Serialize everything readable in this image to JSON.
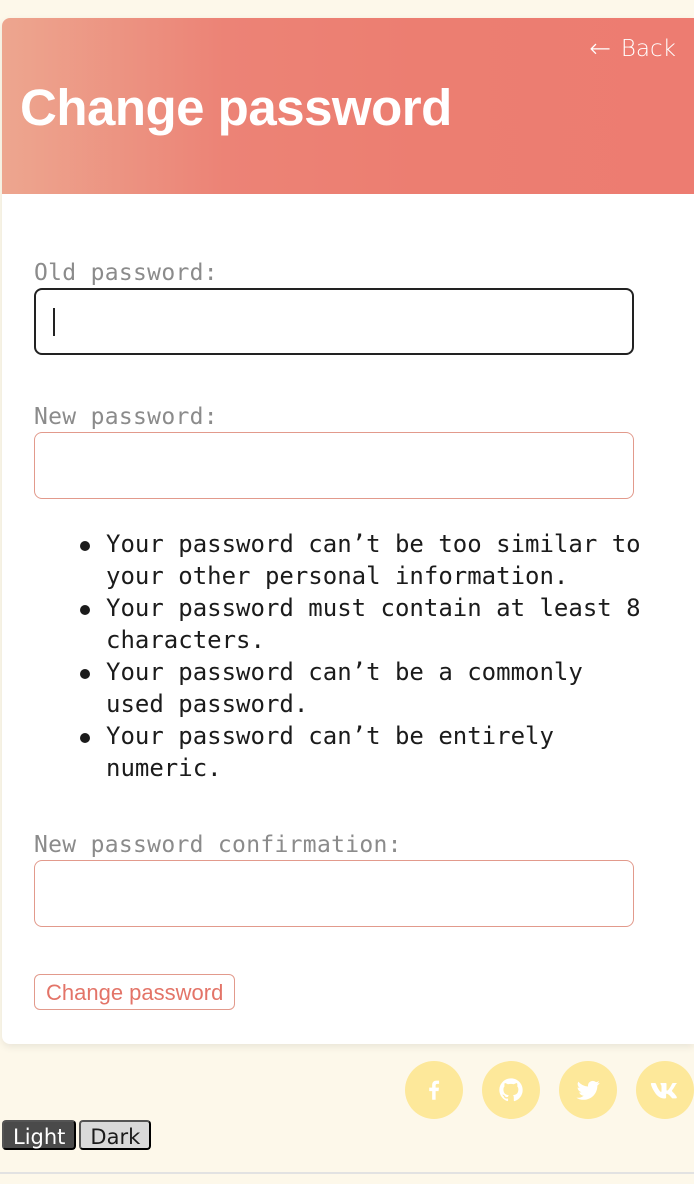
{
  "header": {
    "back_label": "Back",
    "back_arrow": "←",
    "title": "Change password",
    "gradient_colors": [
      "#eda68f",
      "#ec7e71"
    ]
  },
  "form": {
    "old_password_label": "Old password:",
    "old_password_value": "",
    "new_password_label": "New password:",
    "new_password_value": "",
    "help_items": [
      "Your password can’t be too similar to your other personal information.",
      "Your password must contain at least 8 characters.",
      "Your password can’t be a commonly used password.",
      "Your password can’t be entirely numeric."
    ],
    "confirm_label": "New password confirmation:",
    "confirm_value": "",
    "submit_label": "Change password"
  },
  "socials": [
    {
      "icon": "facebook-icon"
    },
    {
      "icon": "github-icon"
    },
    {
      "icon": "twitter-icon"
    },
    {
      "icon": "vk-icon"
    }
  ],
  "theme": {
    "light_label": "Light",
    "dark_label": "Dark",
    "selected": "Light"
  },
  "colors": {
    "accent": "#ec7e71",
    "input_border": "#e29a8c",
    "page_bg": "#fdf8ea",
    "social_bg": "#fde89a"
  }
}
